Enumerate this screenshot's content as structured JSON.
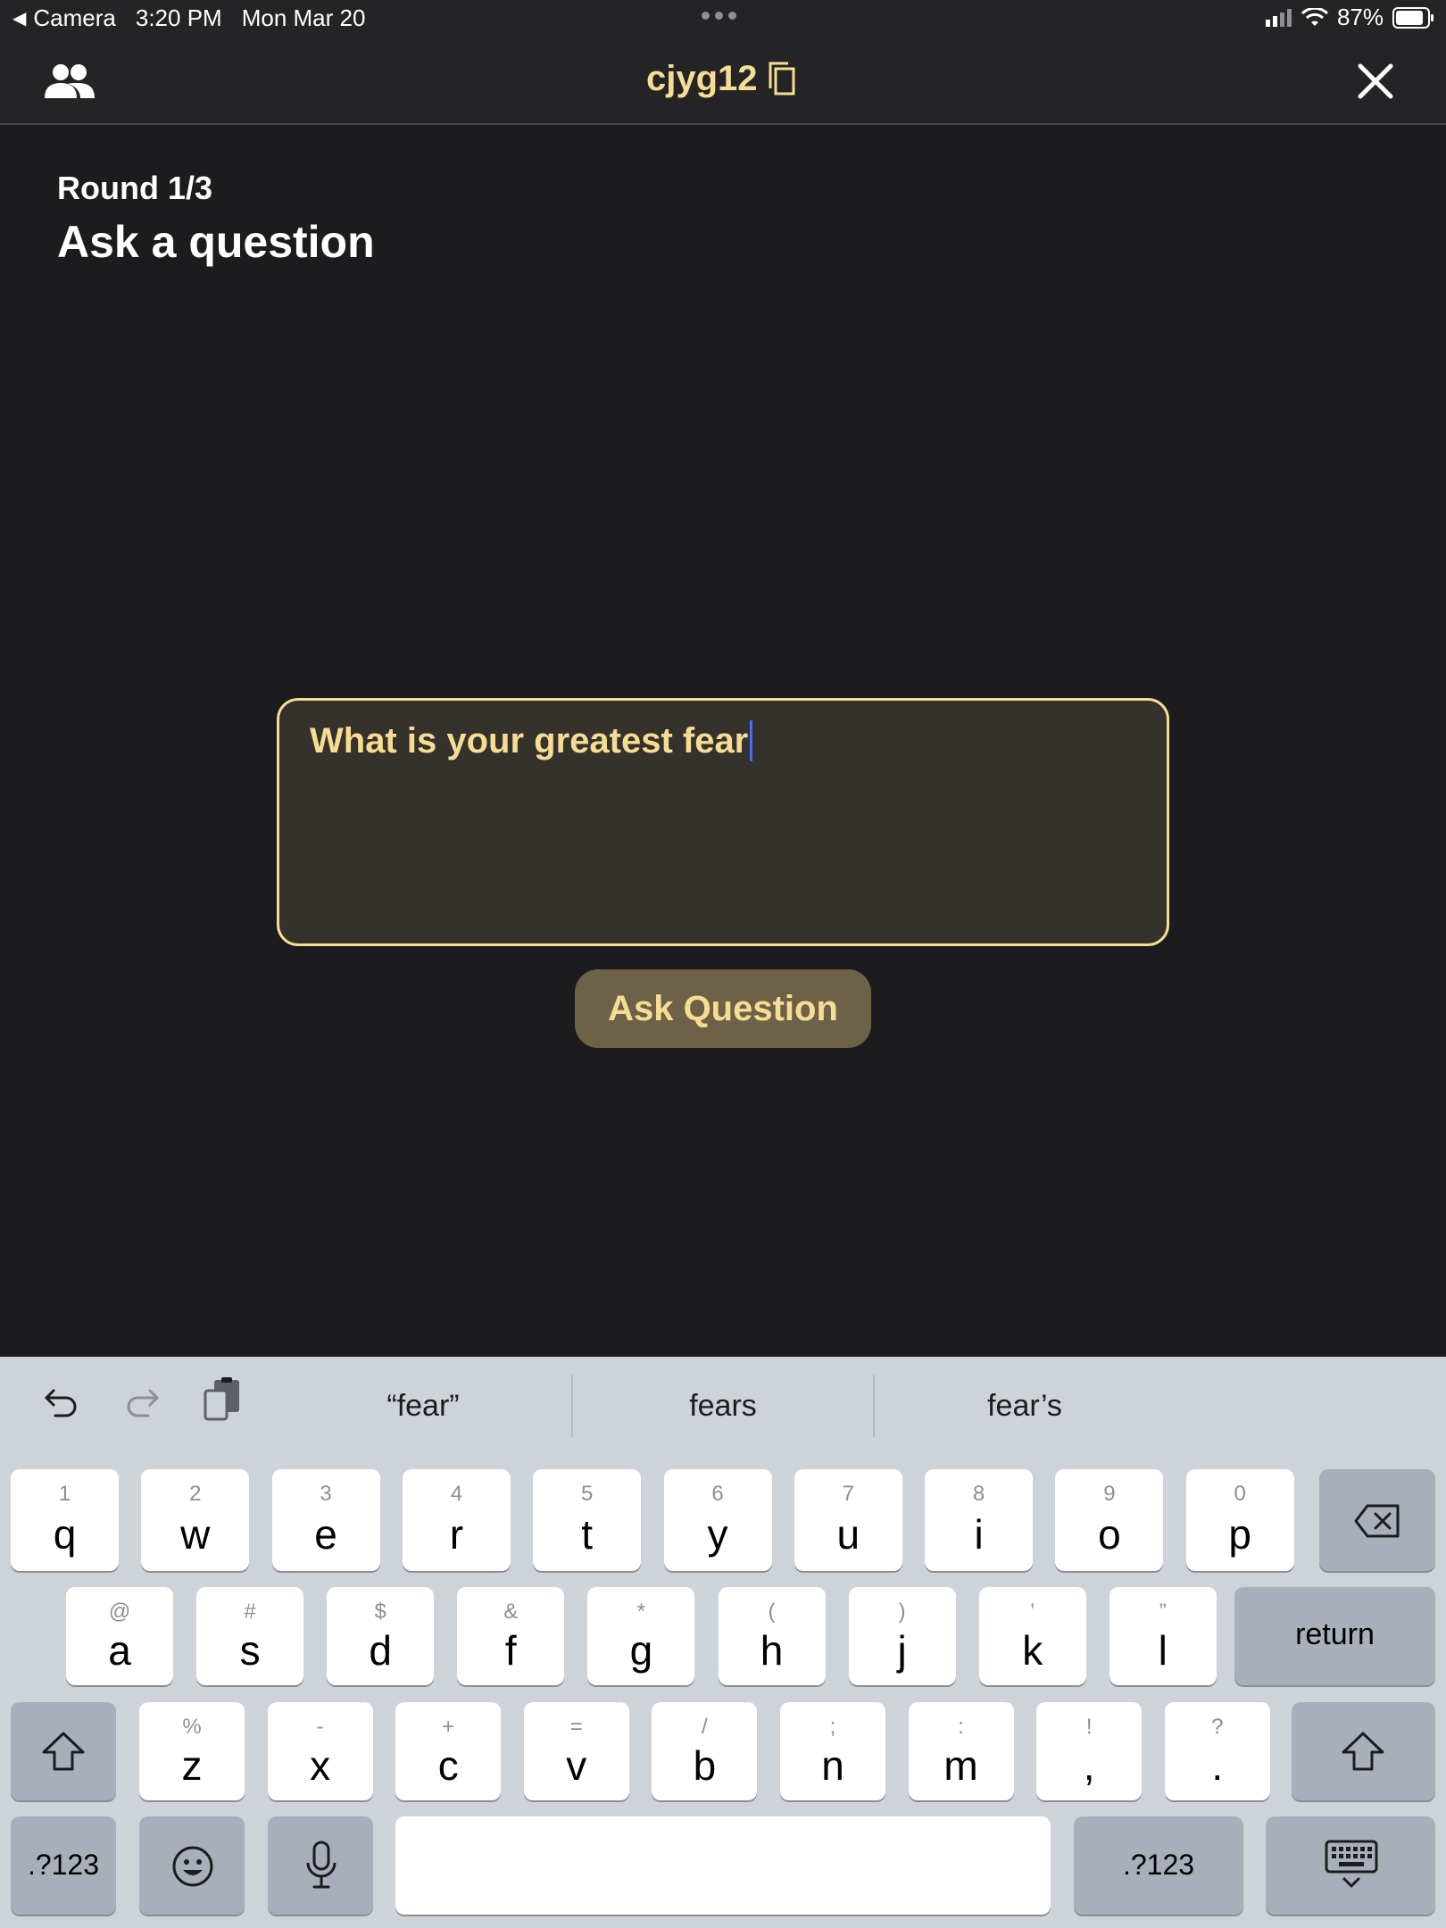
{
  "status_bar": {
    "back_app": "Camera",
    "time": "3:20 PM",
    "date": "Mon Mar 20",
    "battery": "87%"
  },
  "header": {
    "room_code": "cjyg12",
    "icons": [
      "people-icon",
      "copy-icon",
      "close-icon"
    ]
  },
  "game": {
    "round": "Round 1/3",
    "title": "Ask a question",
    "question_value": "What is your greatest fear",
    "ask_button": "Ask Question"
  },
  "colors": {
    "accent": "#f6dd93",
    "background": "#1c1c1e",
    "header": "#242426",
    "input_bg": "#35312c",
    "button_bg": "#6d6247",
    "keyboard_bg": "#ced2d9"
  },
  "keyboard": {
    "suggestions": [
      "“fear”",
      "fears",
      "fear’s"
    ],
    "row1": [
      {
        "sec": "1",
        "key": "q"
      },
      {
        "sec": "2",
        "key": "w"
      },
      {
        "sec": "3",
        "key": "e"
      },
      {
        "sec": "4",
        "key": "r"
      },
      {
        "sec": "5",
        "key": "t"
      },
      {
        "sec": "6",
        "key": "y"
      },
      {
        "sec": "7",
        "key": "u"
      },
      {
        "sec": "8",
        "key": "i"
      },
      {
        "sec": "9",
        "key": "o"
      },
      {
        "sec": "0",
        "key": "p"
      }
    ],
    "row2": [
      {
        "sec": "@",
        "key": "a"
      },
      {
        "sec": "#",
        "key": "s"
      },
      {
        "sec": "$",
        "key": "d"
      },
      {
        "sec": "&",
        "key": "f"
      },
      {
        "sec": "*",
        "key": "g"
      },
      {
        "sec": "(",
        "key": "h"
      },
      {
        "sec": ")",
        "key": "j"
      },
      {
        "sec": "’",
        "key": "k"
      },
      {
        "sec": "”",
        "key": "l"
      }
    ],
    "row3": [
      {
        "sec": "%",
        "key": "z"
      },
      {
        "sec": "-",
        "key": "x"
      },
      {
        "sec": "+",
        "key": "c"
      },
      {
        "sec": "=",
        "key": "v"
      },
      {
        "sec": "/",
        "key": "b"
      },
      {
        "sec": ";",
        "key": "n"
      },
      {
        "sec": ":",
        "key": "m"
      },
      {
        "sec": "!",
        "key": ","
      },
      {
        "sec": "?",
        "key": "."
      }
    ],
    "return_label": "return",
    "numbers_label": ".?123"
  }
}
